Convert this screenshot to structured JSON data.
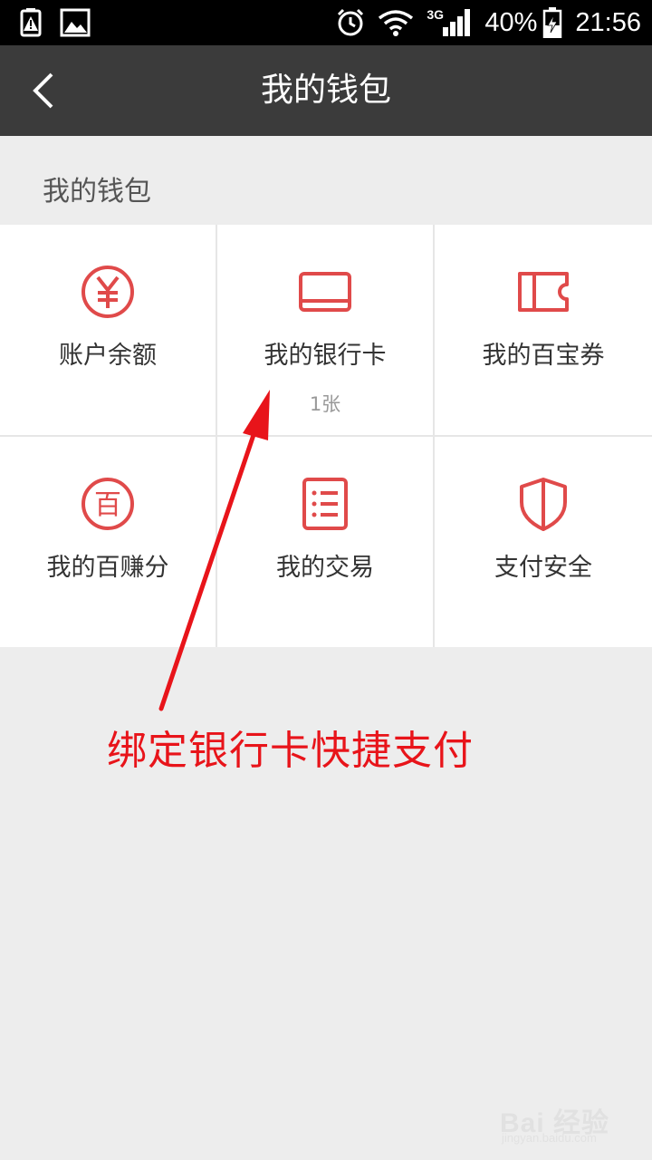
{
  "status_bar": {
    "network": "3G",
    "battery": "40%",
    "time": "21:56",
    "icons": [
      "battery-alert-icon",
      "image-notification-icon",
      "alarm-icon",
      "wifi-icon",
      "signal-icon",
      "battery-charging-icon"
    ]
  },
  "header": {
    "title": "我的钱包",
    "back_icon": "chevron-left-icon"
  },
  "section": {
    "label": "我的钱包"
  },
  "grid": {
    "accent_color": "#e04a4a",
    "items": [
      {
        "label": "账户余额",
        "icon": "yuan-coin-icon"
      },
      {
        "label": "我的银行卡",
        "sub": "1张",
        "icon": "bank-card-icon"
      },
      {
        "label": "我的百宝券",
        "icon": "coupon-ticket-icon"
      },
      {
        "label": "我的百赚分",
        "icon": "bai-points-icon",
        "glyph": "百"
      },
      {
        "label": "我的交易",
        "icon": "transaction-list-icon"
      },
      {
        "label": "支付安全",
        "icon": "security-shield-icon"
      }
    ]
  },
  "annotation": {
    "text": "绑定银行卡快捷支付",
    "color": "#e8141a"
  },
  "watermark": {
    "brand": "Bai 经验",
    "sub": "jingyan.baidu.com"
  }
}
